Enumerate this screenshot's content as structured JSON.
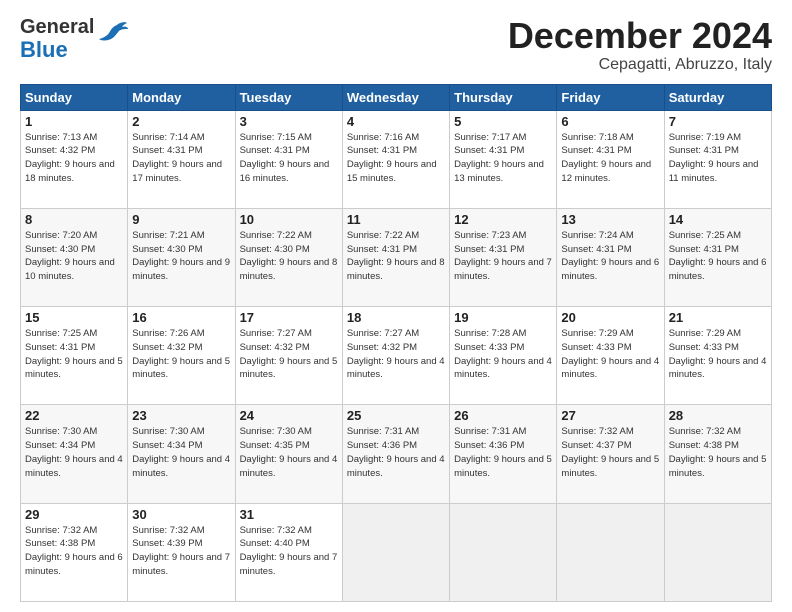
{
  "header": {
    "logo_general": "General",
    "logo_blue": "Blue",
    "month": "December 2024",
    "location": "Cepagatti, Abruzzo, Italy"
  },
  "weekdays": [
    "Sunday",
    "Monday",
    "Tuesday",
    "Wednesday",
    "Thursday",
    "Friday",
    "Saturday"
  ],
  "weeks": [
    [
      {
        "day": 1,
        "sunrise": "7:13 AM",
        "sunset": "4:32 PM",
        "daylight": "9 hours and 18 minutes."
      },
      {
        "day": 2,
        "sunrise": "7:14 AM",
        "sunset": "4:31 PM",
        "daylight": "9 hours and 17 minutes."
      },
      {
        "day": 3,
        "sunrise": "7:15 AM",
        "sunset": "4:31 PM",
        "daylight": "9 hours and 16 minutes."
      },
      {
        "day": 4,
        "sunrise": "7:16 AM",
        "sunset": "4:31 PM",
        "daylight": "9 hours and 15 minutes."
      },
      {
        "day": 5,
        "sunrise": "7:17 AM",
        "sunset": "4:31 PM",
        "daylight": "9 hours and 13 minutes."
      },
      {
        "day": 6,
        "sunrise": "7:18 AM",
        "sunset": "4:31 PM",
        "daylight": "9 hours and 12 minutes."
      },
      {
        "day": 7,
        "sunrise": "7:19 AM",
        "sunset": "4:31 PM",
        "daylight": "9 hours and 11 minutes."
      }
    ],
    [
      {
        "day": 8,
        "sunrise": "7:20 AM",
        "sunset": "4:30 PM",
        "daylight": "9 hours and 10 minutes."
      },
      {
        "day": 9,
        "sunrise": "7:21 AM",
        "sunset": "4:30 PM",
        "daylight": "9 hours and 9 minutes."
      },
      {
        "day": 10,
        "sunrise": "7:22 AM",
        "sunset": "4:30 PM",
        "daylight": "9 hours and 8 minutes."
      },
      {
        "day": 11,
        "sunrise": "7:22 AM",
        "sunset": "4:31 PM",
        "daylight": "9 hours and 8 minutes."
      },
      {
        "day": 12,
        "sunrise": "7:23 AM",
        "sunset": "4:31 PM",
        "daylight": "9 hours and 7 minutes."
      },
      {
        "day": 13,
        "sunrise": "7:24 AM",
        "sunset": "4:31 PM",
        "daylight": "9 hours and 6 minutes."
      },
      {
        "day": 14,
        "sunrise": "7:25 AM",
        "sunset": "4:31 PM",
        "daylight": "9 hours and 6 minutes."
      }
    ],
    [
      {
        "day": 15,
        "sunrise": "7:25 AM",
        "sunset": "4:31 PM",
        "daylight": "9 hours and 5 minutes."
      },
      {
        "day": 16,
        "sunrise": "7:26 AM",
        "sunset": "4:32 PM",
        "daylight": "9 hours and 5 minutes."
      },
      {
        "day": 17,
        "sunrise": "7:27 AM",
        "sunset": "4:32 PM",
        "daylight": "9 hours and 5 minutes."
      },
      {
        "day": 18,
        "sunrise": "7:27 AM",
        "sunset": "4:32 PM",
        "daylight": "9 hours and 4 minutes."
      },
      {
        "day": 19,
        "sunrise": "7:28 AM",
        "sunset": "4:33 PM",
        "daylight": "9 hours and 4 minutes."
      },
      {
        "day": 20,
        "sunrise": "7:29 AM",
        "sunset": "4:33 PM",
        "daylight": "9 hours and 4 minutes."
      },
      {
        "day": 21,
        "sunrise": "7:29 AM",
        "sunset": "4:33 PM",
        "daylight": "9 hours and 4 minutes."
      }
    ],
    [
      {
        "day": 22,
        "sunrise": "7:30 AM",
        "sunset": "4:34 PM",
        "daylight": "9 hours and 4 minutes."
      },
      {
        "day": 23,
        "sunrise": "7:30 AM",
        "sunset": "4:34 PM",
        "daylight": "9 hours and 4 minutes."
      },
      {
        "day": 24,
        "sunrise": "7:30 AM",
        "sunset": "4:35 PM",
        "daylight": "9 hours and 4 minutes."
      },
      {
        "day": 25,
        "sunrise": "7:31 AM",
        "sunset": "4:36 PM",
        "daylight": "9 hours and 4 minutes."
      },
      {
        "day": 26,
        "sunrise": "7:31 AM",
        "sunset": "4:36 PM",
        "daylight": "9 hours and 5 minutes."
      },
      {
        "day": 27,
        "sunrise": "7:32 AM",
        "sunset": "4:37 PM",
        "daylight": "9 hours and 5 minutes."
      },
      {
        "day": 28,
        "sunrise": "7:32 AM",
        "sunset": "4:38 PM",
        "daylight": "9 hours and 5 minutes."
      }
    ],
    [
      {
        "day": 29,
        "sunrise": "7:32 AM",
        "sunset": "4:38 PM",
        "daylight": "9 hours and 6 minutes."
      },
      {
        "day": 30,
        "sunrise": "7:32 AM",
        "sunset": "4:39 PM",
        "daylight": "9 hours and 7 minutes."
      },
      {
        "day": 31,
        "sunrise": "7:32 AM",
        "sunset": "4:40 PM",
        "daylight": "9 hours and 7 minutes."
      },
      null,
      null,
      null,
      null
    ]
  ]
}
